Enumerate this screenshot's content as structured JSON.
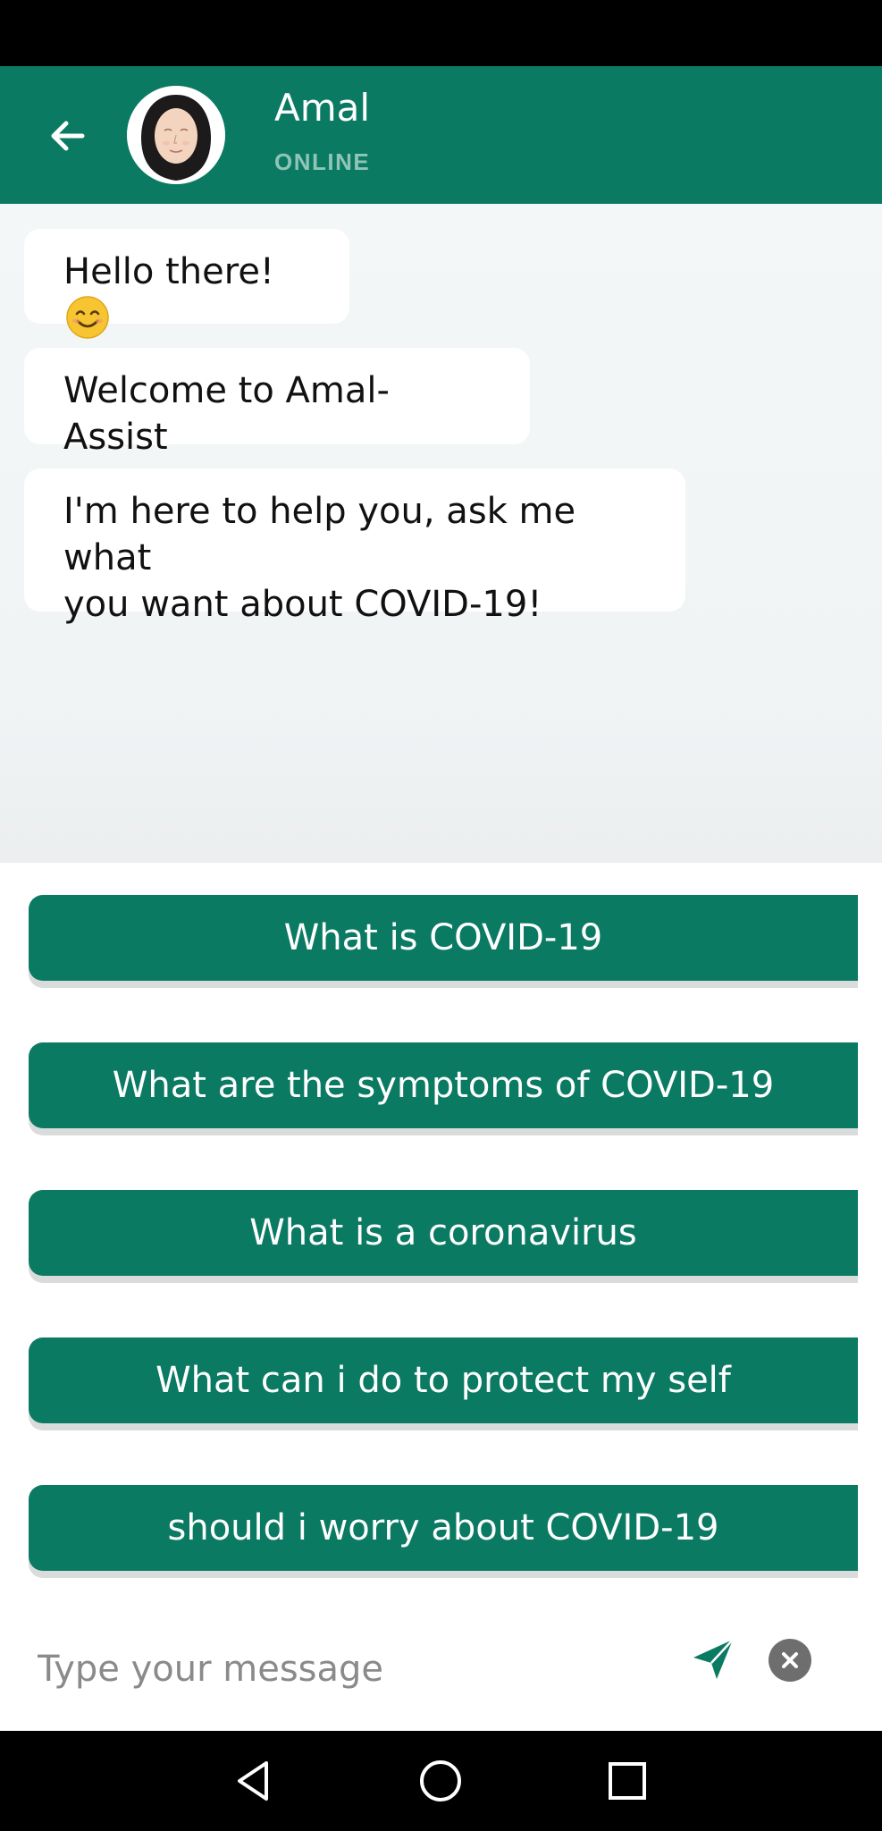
{
  "header": {
    "name": "Amal",
    "status": "ONLINE"
  },
  "messages": [
    {
      "text": "Hello there!",
      "emoji": "smiling-face-emoji"
    },
    {
      "text": "Welcome to Amal-Assist"
    },
    {
      "line1": "I'm here to help you, ask me what",
      "line2": "you want about COVID-19!"
    }
  ],
  "suggestions": [
    "What is COVID-19",
    "What are the symptoms of COVID-19",
    "What is a coronavirus",
    "What can i do to protect my self",
    "should i worry about COVID-19"
  ],
  "composer": {
    "placeholder": "Type your message",
    "value": ""
  },
  "icons": {
    "back": "arrow-left-icon",
    "send": "send-icon",
    "clear": "close-icon",
    "nav_back": "triangle-back-icon",
    "nav_home": "circle-home-icon",
    "nav_recents": "square-recents-icon"
  },
  "colors": {
    "primary": "#0b7a63",
    "chat_bg": "#f1f5f5",
    "bubble_bg": "#ffffff",
    "status_text": "#8fc4b6",
    "clear_button": "#6e6e6e"
  }
}
